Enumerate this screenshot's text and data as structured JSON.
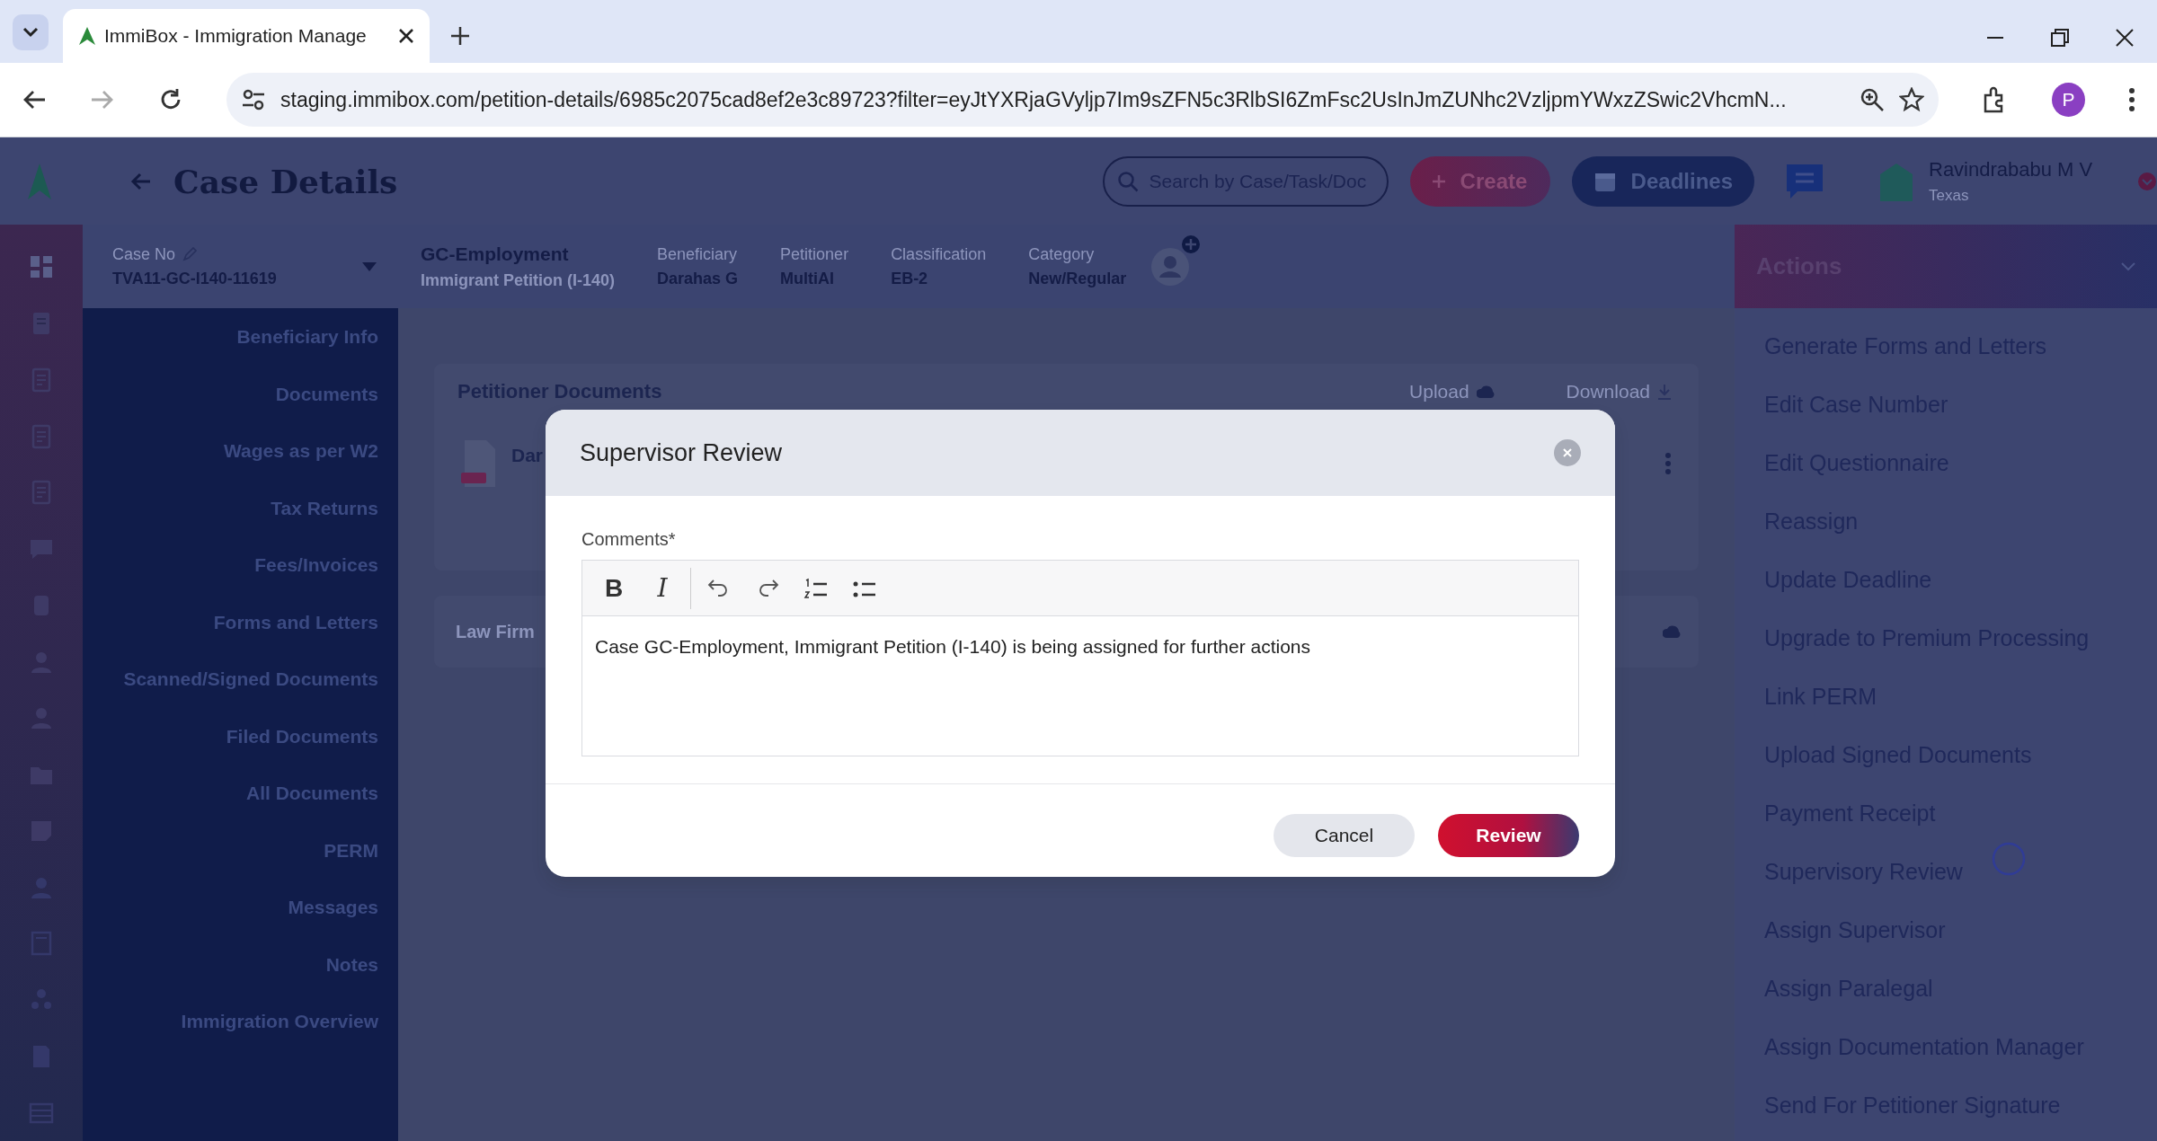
{
  "browser": {
    "tab_title": "ImmiBox - Immigration Manage",
    "url": "staging.immibox.com/petition-details/6985c2075cad8ef2e3c89723?filter=eyJtYXRjaGVyljp7Im9sZFN5c3RlbSI6ZmFsc2UsInJmZUNhc2VzljpmYWxzZSwic2VhcmN...",
    "profile_initial": "P"
  },
  "header": {
    "title": "Case Details",
    "search": {
      "placeholder": "Search by Case/Task/Doc"
    },
    "create_label": "Create",
    "deadlines_label": "Deadlines",
    "user_name": "Ravindrababu M V",
    "user_location": "Texas"
  },
  "case_bar": {
    "case_no_label": "Case No",
    "case_no": "TVA11-GC-I140-11619",
    "case_type": "GC-Employment",
    "case_subtype": "Immigrant Petition (I-140)",
    "fields": [
      {
        "label": "Beneficiary",
        "value": "Darahas G"
      },
      {
        "label": "Petitioner",
        "value": "MultiAI"
      },
      {
        "label": "Classification",
        "value": "EB-2"
      },
      {
        "label": "Category",
        "value": "New/Regular"
      }
    ]
  },
  "sidebar": {
    "items": [
      "Beneficiary Info",
      "Documents",
      "Wages as per W2",
      "Tax Returns",
      "Fees/Invoices",
      "Forms and Letters",
      "Scanned/Signed Documents",
      "Filed Documents",
      "All Documents",
      "PERM",
      "Messages",
      "Notes",
      "Immigration Overview"
    ]
  },
  "content": {
    "sections": [
      {
        "title": "Petitioner Documents",
        "upload": "Upload",
        "download": "Download",
        "file_name": "Dar"
      },
      {
        "title": "Law Firm"
      }
    ]
  },
  "actions": {
    "title": "Actions",
    "items": [
      "Generate Forms and Letters",
      "Edit Case Number",
      "Edit Questionnaire",
      "Reassign",
      "Update Deadline",
      "Upgrade to Premium Processing",
      "Link PERM",
      "Upload Signed Documents",
      "Payment Receipt",
      "Supervisory Review",
      "Assign Supervisor",
      "Assign Paralegal",
      "Assign Documentation Manager",
      "Send For Petitioner Signature"
    ]
  },
  "modal": {
    "title": "Supervisor Review",
    "label": "Comments*",
    "toolbar": [
      "B",
      "I"
    ],
    "comment": "Case GC-Employment, Immigrant Petition (I-140) is being assigned for further actions",
    "cancel": "Cancel",
    "submit": "Review"
  }
}
